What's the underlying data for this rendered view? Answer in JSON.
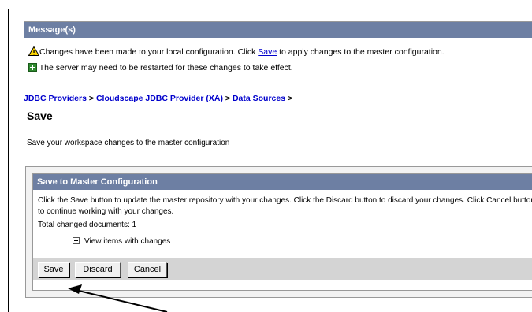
{
  "messages": {
    "header": "Message(s)",
    "line1_before": "Changes have been made to your local configuration. Click ",
    "line1_link": "Save",
    "line1_after": " to apply changes to the master configuration.",
    "line2": "The server may need to be restarted for these changes to take effect."
  },
  "breadcrumb": {
    "items": [
      "JDBC Providers",
      "Cloudscape JDBC Provider (XA)",
      "Data Sources"
    ],
    "separator": ">"
  },
  "page": {
    "title": "Save",
    "description": "Save your workspace changes to the master configuration"
  },
  "save_panel": {
    "header": "Save to Master Configuration",
    "instructions": "Click the Save button to update the master repository with your changes. Click the Discard button to discard your changes. Click Cancel button to continue working with your changes.",
    "total_changed": "Total changed documents: 1",
    "view_items": "View items with changes",
    "buttons": {
      "save": "Save",
      "discard": "Discard",
      "cancel": "Cancel"
    }
  },
  "icons": {
    "warning": "warning-icon",
    "info": "info-icon",
    "expand": "expand-plus-icon"
  },
  "colors": {
    "header_bg": "#6d7fa3",
    "link": "#0000cc",
    "button_bar": "#d4d4d4"
  }
}
